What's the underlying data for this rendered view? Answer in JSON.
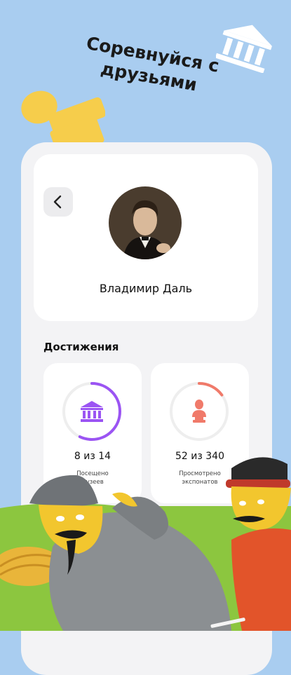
{
  "promo": {
    "headline_line1": "Соревнуйся с",
    "headline_line2": "друзьями"
  },
  "profile": {
    "name": "Владимир Даль"
  },
  "achievements": {
    "title": "Достижения",
    "items": [
      {
        "value": "8 из 14",
        "label_line1": "Посещено",
        "label_line2": "музеев",
        "progress": 0.57,
        "color": "#9b54f3",
        "icon": "museum-icon"
      },
      {
        "value": "52 из 340",
        "label_line1": "Просмотрено",
        "label_line2": "экспонатов",
        "progress": 0.15,
        "color": "#f07a6a",
        "icon": "bust-icon"
      }
    ]
  },
  "colors": {
    "background": "#a9cdf0",
    "accent_purple": "#9b54f3",
    "accent_coral": "#f07a6a",
    "grass": "#8cc63f",
    "stamp_yellow": "#f6cd4b"
  }
}
